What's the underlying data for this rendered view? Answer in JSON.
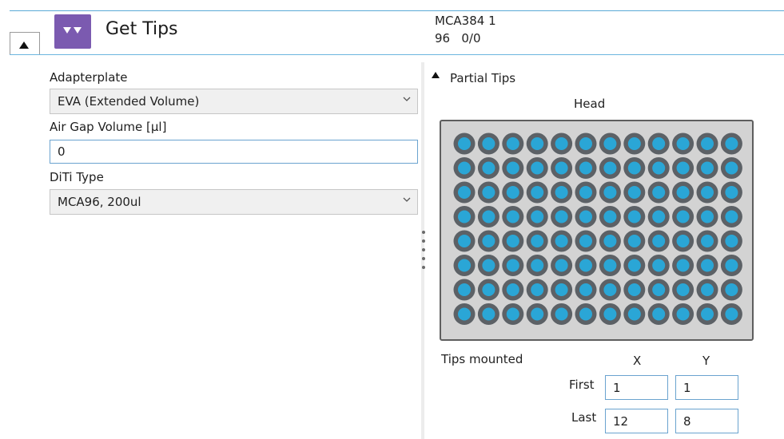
{
  "header": {
    "title": "Get Tips",
    "device_name": "MCA384 1",
    "device_info": "96   0/0",
    "icon": "down-arrows-icon",
    "colors": {
      "icon_bg": "#7b5ab0",
      "accent_line": "#5aa9d6"
    }
  },
  "form": {
    "adapterplate": {
      "label": "Adapterplate",
      "value": "EVA (Extended Volume)"
    },
    "air_gap": {
      "label": "Air Gap Volume [µl]",
      "value": "0"
    },
    "diti_type": {
      "label": "DiTi Type",
      "value": "MCA96, 200ul"
    }
  },
  "partial_tips": {
    "title": "Partial Tips",
    "head_label": "Head",
    "grid": {
      "columns": 12,
      "rows": 8
    },
    "colors": {
      "tip_fill": "#2aa6d6",
      "tip_ring": "#5c6166",
      "plate_bg": "#d3d3d3"
    },
    "tips_mounted": {
      "label": "Tips mounted",
      "x_header": "X",
      "y_header": "Y",
      "first_label": "First",
      "last_label": "Last",
      "first_x": "1",
      "first_y": "1",
      "last_x": "12",
      "last_y": "8"
    }
  }
}
